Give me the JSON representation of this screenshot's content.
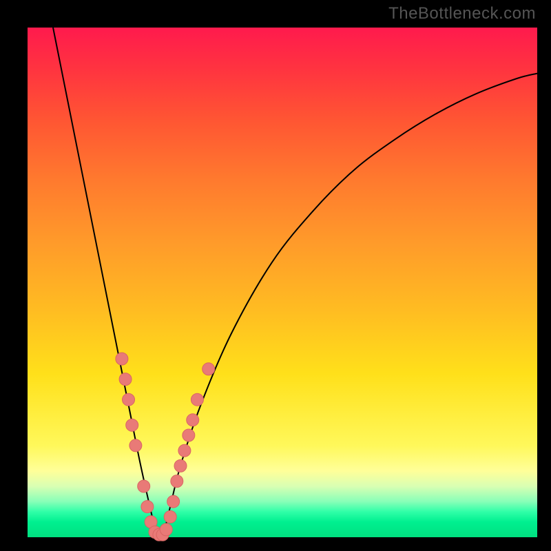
{
  "watermark": "TheBottleneck.com",
  "colors": {
    "frame": "#000000",
    "gradient_top": "#ff1a4d",
    "gradient_bottom": "#00e080",
    "curve_stroke": "#000000",
    "marker_fill": "#e97a77",
    "marker_stroke": "#d96663"
  },
  "chart_data": {
    "type": "line",
    "title": "",
    "xlabel": "",
    "ylabel": "",
    "xlim": [
      0,
      100
    ],
    "ylim": [
      0,
      100
    ],
    "grid": false,
    "series": [
      {
        "name": "bottleneck-curve",
        "x": [
          5,
          8,
          12,
          16,
          20,
          22,
          24,
          25,
          26,
          27,
          28,
          30,
          34,
          40,
          48,
          56,
          64,
          72,
          80,
          88,
          96,
          100
        ],
        "y": [
          100,
          85,
          65,
          45,
          25,
          15,
          6,
          2,
          0,
          2,
          6,
          14,
          26,
          40,
          54,
          64,
          72,
          78,
          83,
          87,
          90,
          91
        ]
      }
    ],
    "markers": [
      {
        "x": 18.5,
        "y": 35
      },
      {
        "x": 19.2,
        "y": 31
      },
      {
        "x": 19.8,
        "y": 27
      },
      {
        "x": 20.5,
        "y": 22
      },
      {
        "x": 21.2,
        "y": 18
      },
      {
        "x": 22.8,
        "y": 10
      },
      {
        "x": 23.5,
        "y": 6
      },
      {
        "x": 24.2,
        "y": 3
      },
      {
        "x": 25.0,
        "y": 1
      },
      {
        "x": 25.8,
        "y": 0.5
      },
      {
        "x": 26.5,
        "y": 0.5
      },
      {
        "x": 27.2,
        "y": 1.5
      },
      {
        "x": 28.0,
        "y": 4
      },
      {
        "x": 28.6,
        "y": 7
      },
      {
        "x": 29.3,
        "y": 11
      },
      {
        "x": 30.0,
        "y": 14
      },
      {
        "x": 30.8,
        "y": 17
      },
      {
        "x": 31.6,
        "y": 20
      },
      {
        "x": 32.4,
        "y": 23
      },
      {
        "x": 33.3,
        "y": 27
      },
      {
        "x": 35.5,
        "y": 33
      }
    ]
  }
}
